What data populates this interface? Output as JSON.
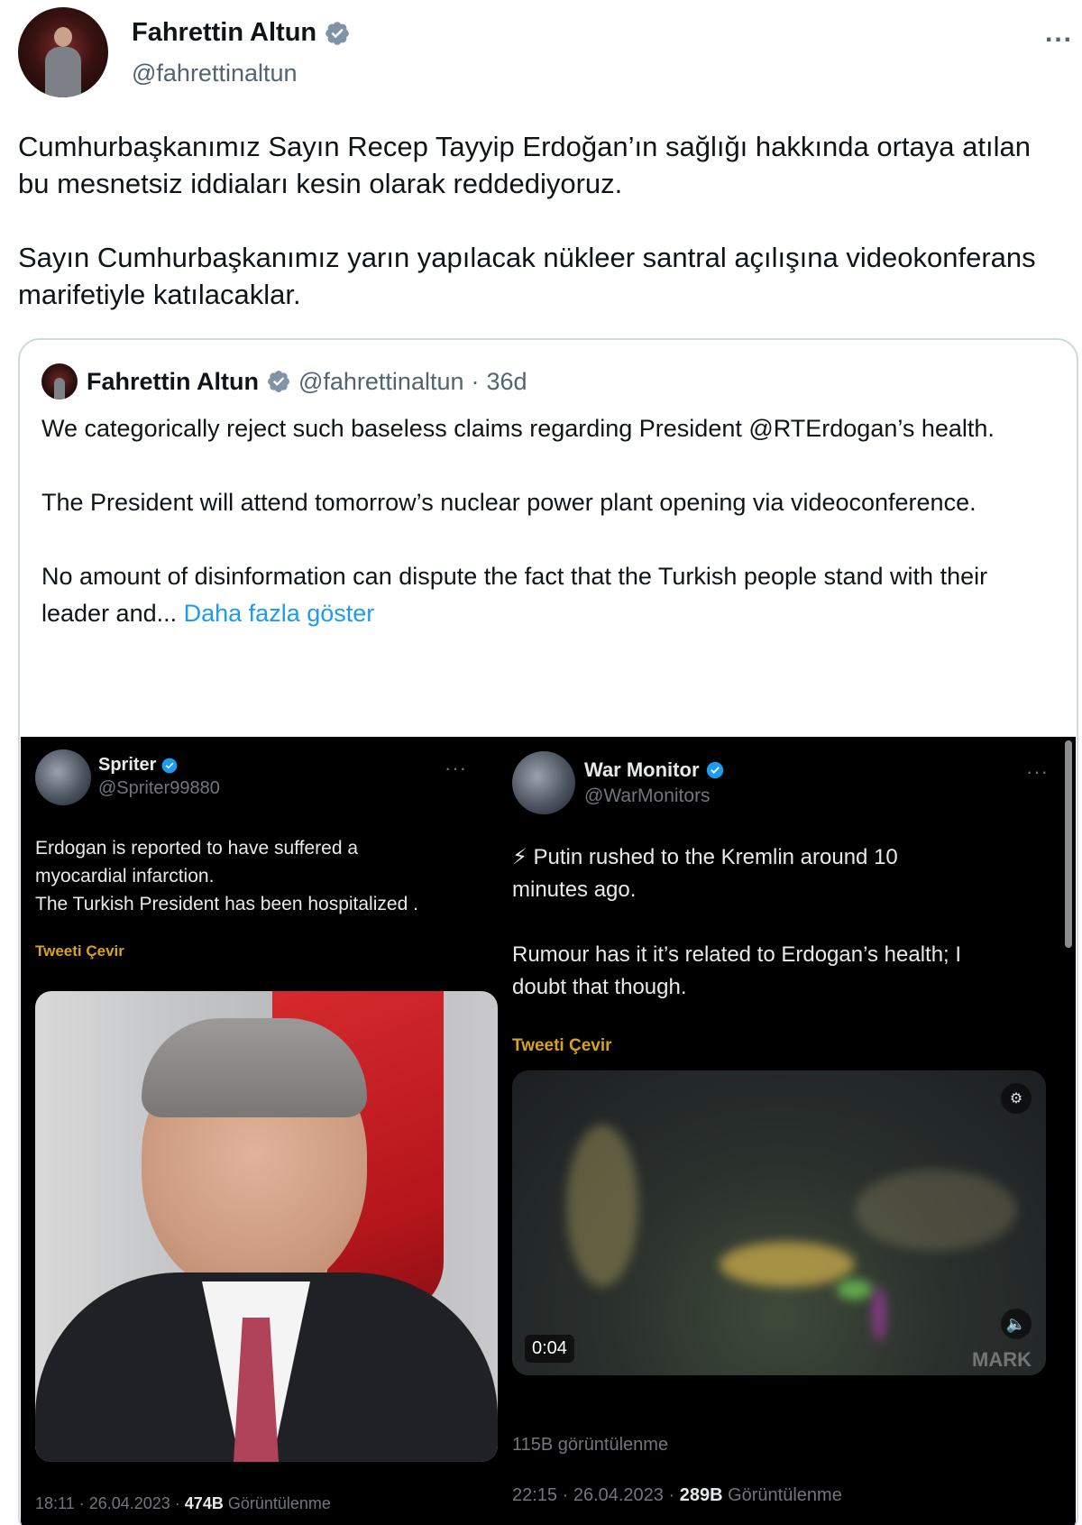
{
  "tweet": {
    "author_name": "Fahrettin Altun",
    "author_handle": "@fahrettinaltun",
    "more_icon": "...",
    "paragraphs": [
      "Cumhurbaşkanımız Sayın Recep Tayyip  Erdoğan’ın sağlığı hakkında ortaya atılan bu mesnetsiz iddiaları kesin olarak reddediyoruz.",
      "Sayın Cumhurbaşkanımız yarın yapılacak nükleer santral açılışına videokonferans marifetiyle katılacaklar."
    ]
  },
  "quoted": {
    "author_name": "Fahrettin Altun",
    "author_handle": "@fahrettinaltun",
    "separator": "·",
    "age": "36d",
    "paragraphs": [
      "We categorically reject such baseless claims regarding President @RTErdogan’s health.",
      "The President will attend tomorrow’s nuclear power plant opening via videoconference.",
      "No amount of disinformation can dispute the fact that the Turkish people stand with their leader and..."
    ],
    "show_more": "Daha fazla göster",
    "embedded": {
      "left": {
        "name": "Spriter",
        "handle": "@Spriter99880",
        "more_icon": "···",
        "lines": [
          "Erdogan is reported to have suffered a",
          "myocardial infarction.",
          "The Turkish President has been hospitalized ."
        ],
        "translate": "Tweeti Çevir",
        "meta_time": "18:11 · 26.04.2023 · ",
        "meta_views": "474B",
        "meta_views_label": " Görüntülenme"
      },
      "right": {
        "name": "War Monitor",
        "handle": "@WarMonitors",
        "more_icon": "···",
        "lines": [
          "⚡ Putin rushed to the Kremlin around 10",
          "minutes ago."
        ],
        "lines2": [
          "Rumour has it it’s related to Erdogan’s health; I",
          "doubt that though."
        ],
        "translate": "Tweeti Çevir",
        "video_time": "0:04",
        "video_watermark": "MARK",
        "views_line": "115B görüntülenme",
        "meta_time": "22:15 · 26.04.2023 · ",
        "meta_views": "289B",
        "meta_views_label": " Görüntülenme"
      }
    }
  },
  "colors": {
    "text": "#0f1419",
    "secondary": "#536471",
    "link": "#1d9bf0",
    "verified": "#1d9bf0",
    "translate": "#d8a319"
  }
}
